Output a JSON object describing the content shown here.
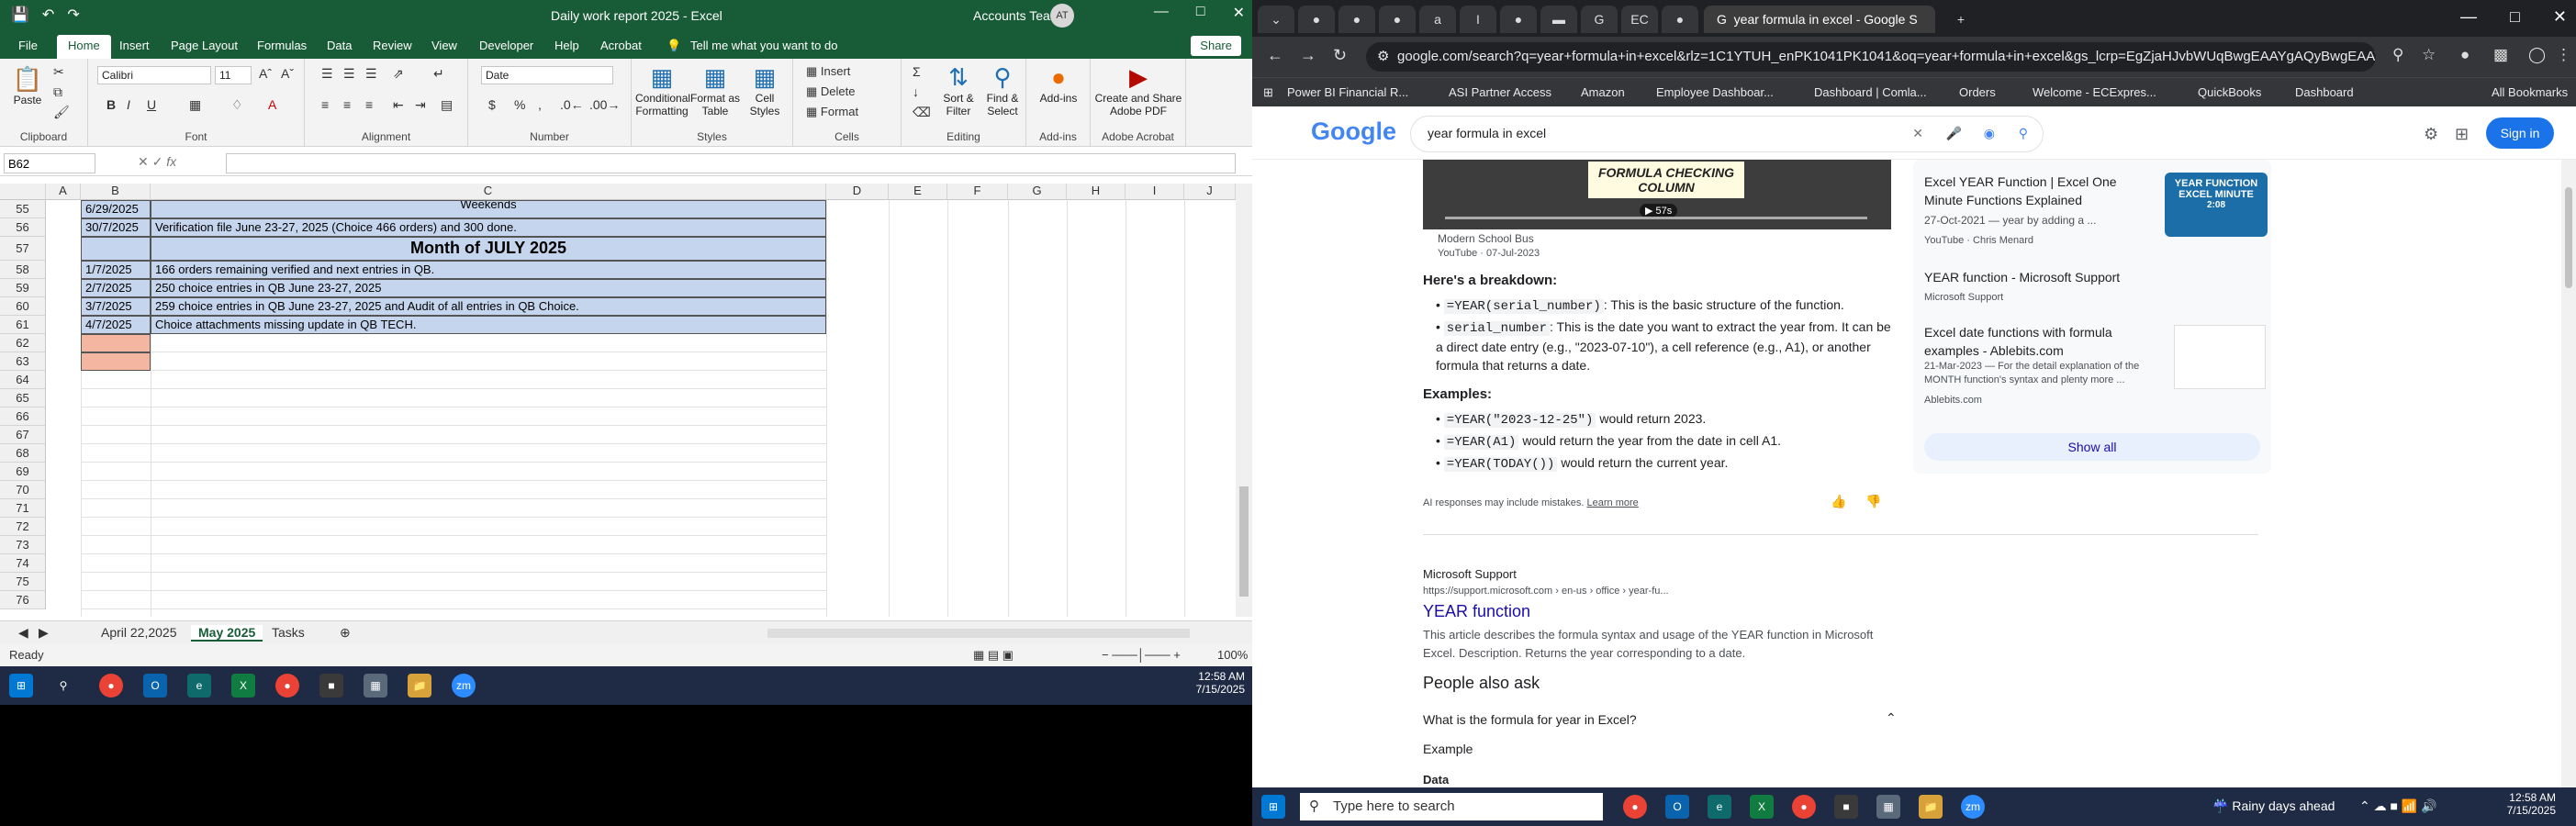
{
  "excel": {
    "qat_icons": [
      "save-icon",
      "undo-icon",
      "redo-icon"
    ],
    "doc_title": "Daily work report 2025  -  Excel",
    "account": "Accounts Team",
    "avatar": "AT",
    "tabs": [
      "File",
      "Home",
      "Insert",
      "Page Layout",
      "Formulas",
      "Data",
      "Review",
      "View",
      "Developer",
      "Help",
      "Acrobat"
    ],
    "tell_me": "Tell me what you want to do",
    "share": "Share",
    "ribbon": {
      "paste": "Paste",
      "font_name": "Calibri",
      "font_size": "11",
      "number_format": "Date",
      "insert": "Insert",
      "delete": "Delete",
      "format": "Format",
      "conditional": "Conditional Formatting",
      "format_table": "Format as Table",
      "cell_styles": "Cell Styles",
      "sort_filter": "Sort & Filter",
      "find_select": "Find & Select",
      "addins": "Add-ins",
      "create_share": "Create and Share Adobe PDF",
      "groups": [
        "Clipboard",
        "Font",
        "Alignment",
        "Number",
        "Styles",
        "Cells",
        "Editing",
        "Add-ins",
        "Adobe Acrobat"
      ]
    },
    "name_box": "B62",
    "columns": [
      "A",
      "B",
      "C",
      "D",
      "E",
      "F",
      "G",
      "H",
      "I",
      "J"
    ],
    "rows": [
      {
        "num": "55",
        "b": "6/29/2025",
        "c": "Weekends",
        "style": "blue"
      },
      {
        "num": "56",
        "b": "30/7/2025",
        "c": "Verification file June 23-27, 2025 (Choice 466 orders) and 300 done.",
        "style": "blue"
      },
      {
        "num": "57",
        "b": "",
        "c": "Month of JULY 2025",
        "style": "header"
      },
      {
        "num": "58",
        "b": "1/7/2025",
        "c": "166 orders remaining verified and next entries in QB.",
        "style": "blue"
      },
      {
        "num": "59",
        "b": "2/7/2025",
        "c": "250 choice entries in QB June 23-27, 2025",
        "style": "blue"
      },
      {
        "num": "60",
        "b": "3/7/2025",
        "c": "259 choice entries in QB June 23-27, 2025 and Audit of all entries in QB Choice.",
        "style": "blue"
      },
      {
        "num": "61",
        "b": "4/7/2025",
        "c": "Choice attachments missing update in QB TECH.",
        "style": "blue"
      },
      {
        "num": "62",
        "b": "",
        "c": "",
        "style": "sel"
      },
      {
        "num": "63",
        "b": "",
        "c": "",
        "style": "sel"
      },
      {
        "num": "64",
        "b": "",
        "c": "",
        "style": "none"
      },
      {
        "num": "65",
        "b": "",
        "c": "",
        "style": "none"
      },
      {
        "num": "66",
        "b": "",
        "c": "",
        "style": "none"
      },
      {
        "num": "67",
        "b": "",
        "c": "",
        "style": "none"
      },
      {
        "num": "68",
        "b": "",
        "c": "",
        "style": "none"
      },
      {
        "num": "69",
        "b": "",
        "c": "",
        "style": "none"
      },
      {
        "num": "70",
        "b": "",
        "c": "",
        "style": "none"
      },
      {
        "num": "71",
        "b": "",
        "c": "",
        "style": "none"
      },
      {
        "num": "72",
        "b": "",
        "c": "",
        "style": "none"
      },
      {
        "num": "73",
        "b": "",
        "c": "",
        "style": "none"
      },
      {
        "num": "74",
        "b": "",
        "c": "",
        "style": "none"
      },
      {
        "num": "75",
        "b": "",
        "c": "",
        "style": "none"
      },
      {
        "num": "76",
        "b": "",
        "c": "",
        "style": "none"
      }
    ],
    "sheets": [
      "April 22,2025",
      "May 2025",
      "Tasks"
    ],
    "active_sheet": 1,
    "status": "Ready",
    "zoom": "100%",
    "clock_time": "12:58 AM",
    "clock_date": "7/15/2025"
  },
  "chrome": {
    "active_tab_title": "year formula in excel - Google S",
    "url": "google.com/search?q=year+formula+in+excel&rlz=1C1YTUH_enPK1041PK1041&oq=year+formula+in+excel&gs_lcrp=EgZjaHJvbWUqBwgEAAYgAQyBwgEAAYgAQyBggBE...",
    "bookmarks": [
      "Power BI Financial R...",
      "ASI Partner Access",
      "Amazon",
      "Employee Dashboar...",
      "Dashboard | Comla...",
      "Orders",
      "Welcome - ECExpres...",
      "QuickBooks",
      "Dashboard",
      "All Bookmarks"
    ],
    "logo": "Google",
    "query": "year formula in excel",
    "sign_in": "Sign in",
    "video": {
      "overlay": "FORMULA CHECKING COLUMN",
      "duration": "57s",
      "source": "Modern School Bus",
      "site": "YouTube · 07-Jul-2023"
    },
    "breakdown_title": "Here's a breakdown:",
    "bullets": [
      {
        "code": "=YEAR(serial_number)",
        "text": ": This is the basic structure of the function."
      },
      {
        "code": "serial_number",
        "text": ": This is the date you want to extract the year from. It can be a direct date entry (e.g., \"2023-07-10\"), a cell reference (e.g., A1), or another formula that returns a date."
      }
    ],
    "examples_title": "Examples:",
    "examples": [
      {
        "code": "=YEAR(\"2023-12-25\")",
        "text": "would return 2023."
      },
      {
        "code": "=YEAR(A1)",
        "text": "would return the year from the date in cell A1."
      },
      {
        "code": "=YEAR(TODAY())",
        "text": "would return the current year."
      }
    ],
    "ai_note": "AI responses may include mistakes.",
    "learn_more": "Learn more",
    "side_results": [
      {
        "title": "Excel YEAR Function | Excel One Minute Functions Explained",
        "meta": "27-Oct-2021 — year by adding a ...",
        "source": "YouTube · Chris Menard",
        "thumb": "YEAR FUNCTION EXCEL MINUTE",
        "duration": "2:08"
      },
      {
        "title": "YEAR function - Microsoft Support",
        "source": "Microsoft Support"
      },
      {
        "title": "Excel date functions with formula examples - Ablebits.com",
        "meta": "21-Mar-2023 — For the detail explanation of the MONTH function's syntax and plenty more ...",
        "source": "Ablebits.com"
      }
    ],
    "show_all": "Show all",
    "result": {
      "site": "Microsoft Support",
      "url": "https://support.microsoft.com › en-us › office › year-fu...",
      "title": "YEAR function",
      "snippet": "This article describes the formula syntax and usage of the YEAR function in Microsoft Excel. Description. Returns the year corresponding to a date."
    },
    "paa_title": "People also ask",
    "paa_q": "What is the formula for year in Excel?",
    "paa_example": "Example",
    "paa_data": "Data",
    "search_placeholder": "Type here to search",
    "weather": "Rainy days ahead",
    "clock_time": "12:58 AM",
    "clock_date": "7/15/2025"
  }
}
